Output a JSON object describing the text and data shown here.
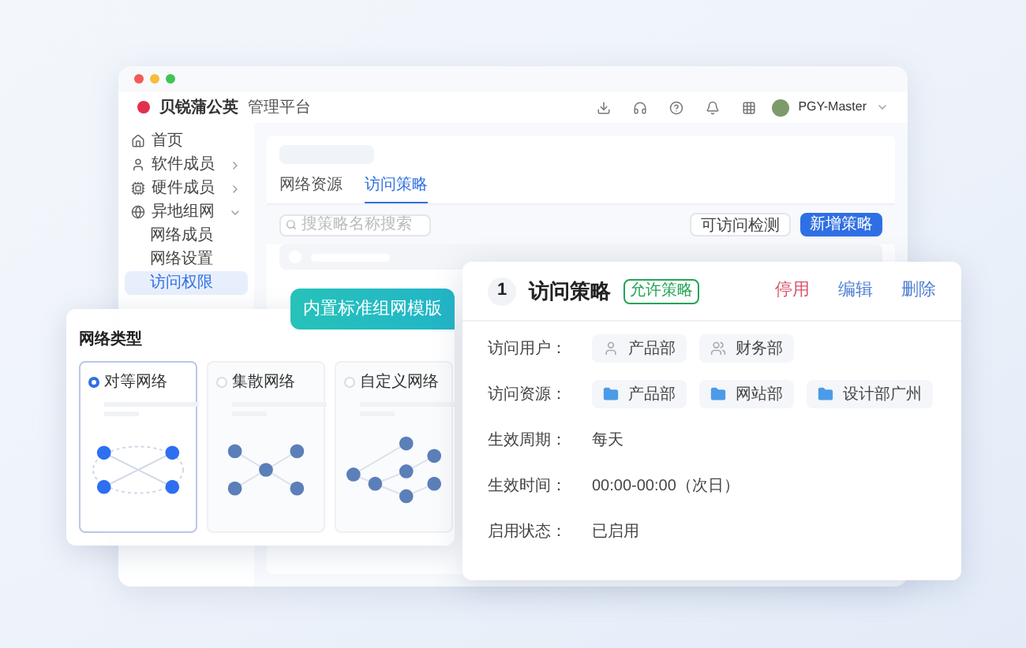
{
  "header": {
    "brand": "贝锐蒲公英",
    "subtitle": "管理平台",
    "user": "PGY-Master"
  },
  "sidebar": {
    "items": [
      {
        "label": "首页",
        "selected": false
      },
      {
        "label": "软件成员",
        "selected": false,
        "expanded": false
      },
      {
        "label": "硬件成员",
        "selected": false,
        "expanded": false
      },
      {
        "label": "异地组网",
        "selected": false,
        "expanded": true,
        "children": [
          {
            "label": "网络成员",
            "selected": false
          },
          {
            "label": "网络设置",
            "selected": false
          },
          {
            "label": "访问权限",
            "selected": true
          }
        ]
      }
    ]
  },
  "tabs": [
    {
      "label": "网络资源",
      "selected": false
    },
    {
      "label": "访问策略",
      "selected": true
    }
  ],
  "search": {
    "placeholder": "搜策略名称搜索"
  },
  "buttons": [
    {
      "label": "可访问检测",
      "kind": "secondary"
    },
    {
      "label": "新增策略",
      "kind": "primary"
    }
  ],
  "banner": "内置标准组网模版",
  "network_types": {
    "title": "网络类型",
    "options": [
      {
        "label": "对等网络",
        "selected": true,
        "kind": "mesh"
      },
      {
        "label": "集散网络",
        "selected": false,
        "kind": "hub"
      },
      {
        "label": "自定义网络",
        "selected": false,
        "kind": "custom"
      }
    ]
  },
  "policy": {
    "index": "1",
    "title": "访问策略",
    "badge": "允许策略",
    "actions": [
      {
        "label": "停用",
        "kind": "danger"
      },
      {
        "label": "编辑",
        "kind": "normal"
      },
      {
        "label": "删除",
        "kind": "normal"
      }
    ],
    "fields": [
      {
        "label": "访问用户：",
        "kind": "chips",
        "chips": [
          {
            "text": "产品部",
            "kind": "user"
          },
          {
            "text": "财务部",
            "kind": "group"
          }
        ]
      },
      {
        "label": "访问资源：",
        "kind": "chips",
        "chips": [
          {
            "text": "产品部",
            "kind": "folder"
          },
          {
            "text": "网站部",
            "kind": "folder"
          },
          {
            "text": "设计部广州",
            "kind": "folder"
          }
        ]
      },
      {
        "label": "生效周期：",
        "kind": "text",
        "value": "每天"
      },
      {
        "label": "生效时间：",
        "kind": "text",
        "value": "00:00-00:00（次日）"
      },
      {
        "label": "启用状态：",
        "kind": "text",
        "value": "已启用"
      }
    ]
  }
}
